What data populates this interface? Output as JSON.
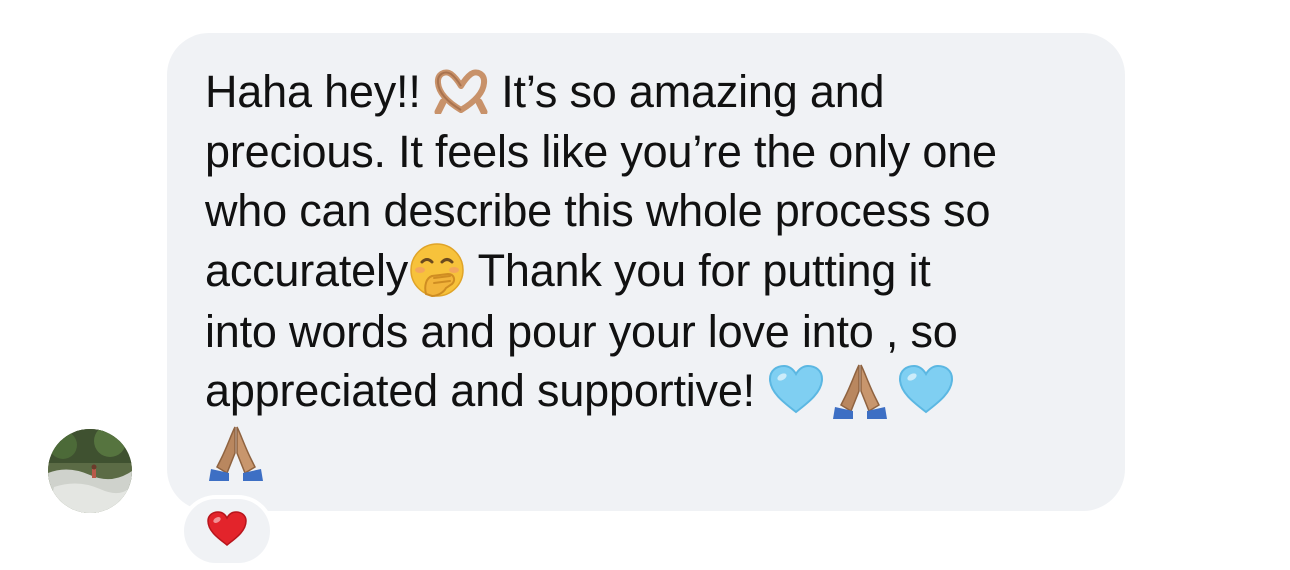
{
  "message": {
    "lines": [
      {
        "pre": "Haha hey!! ",
        "emoji": "heart-hands-icon",
        "post": " It’s so amazing and"
      },
      {
        "text": "precious. It feels like you’re the only one"
      },
      {
        "text": "who can describe this whole process so"
      },
      {
        "pre": "accurately",
        "emoji": "hand-over-mouth-face-icon",
        "post": " Thank you for putting it"
      },
      {
        "text": "into words and pour your love into , so"
      },
      {
        "text": "appreciated and supportive! "
      }
    ],
    "trailing_emojis": [
      "light-blue-heart-icon",
      "folded-hands-icon",
      "light-blue-heart-icon",
      "folded-hands-icon"
    ]
  },
  "reaction": {
    "emoji": "red-heart-icon"
  },
  "colors": {
    "bubble_background": "#f0f2f5",
    "text": "#111111",
    "light_blue_heart": "#7fcff2",
    "red_heart": "#e3242b"
  }
}
